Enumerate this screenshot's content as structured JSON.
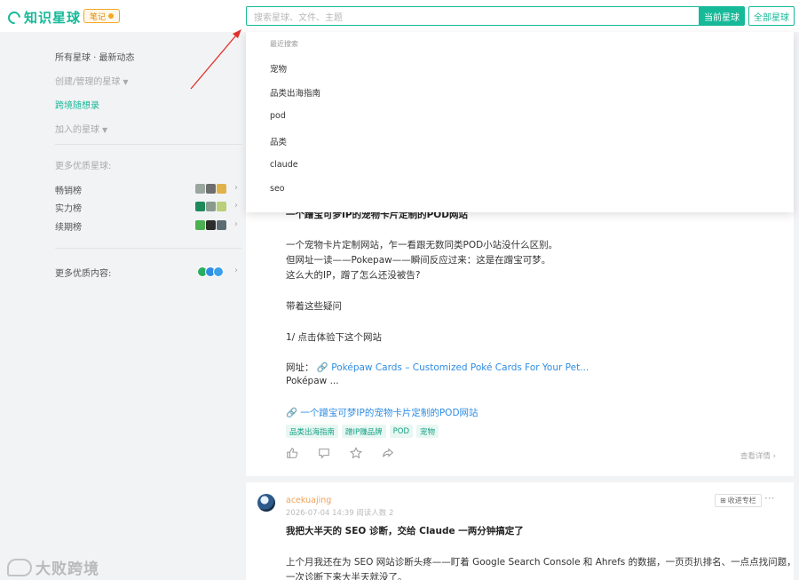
{
  "header": {
    "logo_text": "知识星球",
    "note_badge": "笔记",
    "search_placeholder": "搜索星球、文件、主题",
    "btn_current": "当前星球",
    "btn_all": "全部星球"
  },
  "sidebar": {
    "all_updates": "所有星球 · 最新动态",
    "created": "创建/管理的星球",
    "active_planet": "跨境随想录",
    "joined": "加入的星球",
    "more_planets": "更多优质星球:",
    "rank_sales": "畅销榜",
    "rank_strength": "实力榜",
    "rank_renew": "续期榜",
    "more_content": "更多优质内容:"
  },
  "dropdown": {
    "header": "最近搜索",
    "items": [
      "宠物",
      "品类出海指南",
      "pod",
      "品类",
      "claude",
      "seo"
    ]
  },
  "post1": {
    "title": "一个蹭宝可梦IP的宠物卡片定制的POD网站",
    "line1": "一个宠物卡片定制网站，乍一看跟无数同类POD小站没什么区别。",
    "line2": "但网址一读——Pokepaw——瞬间反应过来：这是在蹭宝可梦。",
    "line3": "这么大的IP，蹭了怎么还没被告?",
    "line4": "带着这些疑问",
    "line5": "1/ 点击体验下这个网站",
    "url_label": "网址：",
    "url_link": "Poképaw Cards – Customized Poké Cards For Your Pet...",
    "line6": "Poképaw  ...",
    "bottom_link": "一个蹭宝可梦IP的宠物卡片定制的POD网站",
    "tags": [
      "品类出海指南",
      "蹭IP赚品牌",
      "POD",
      "宠物"
    ],
    "details": "查看详情"
  },
  "post2": {
    "author": "acekuajing",
    "meta": "2026-07-04 14:39  阅读人数 2",
    "fav": "收进专栏",
    "title": "我把大半天的 SEO 诊断，交给 Claude 一两分钟搞定了",
    "line1": "上个月我还在为 SEO 网站诊断头疼——盯着 Google Search Console 和 Ahrefs 的数据，一页页扒排名、一点点找问题，",
    "line2": "一次诊断下来大半天就没了。"
  },
  "watermark": "大败跨境",
  "colors": {
    "brand": "#16b998",
    "link": "#2f8de4",
    "author": "#f0a15a"
  }
}
